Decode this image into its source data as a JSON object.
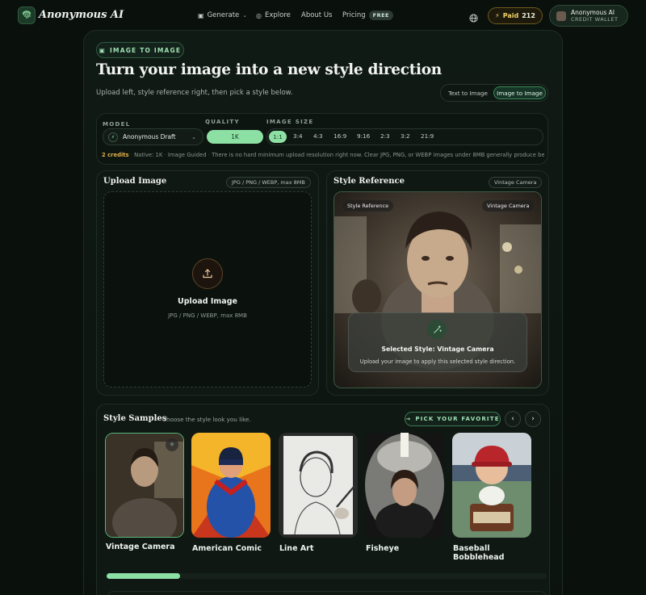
{
  "nav": {
    "brand": "Anonymous AI",
    "links": {
      "generate": "Generate",
      "explore": "Explore",
      "about": "About Us",
      "pricing": "Pricing"
    },
    "free_badge": "FREE",
    "paid_label": "Paid",
    "paid_count": "212",
    "wallet_name": "Anonymous AI",
    "wallet_sub": "CREDIT WALLET"
  },
  "hero": {
    "chip": "IMAGE TO IMAGE",
    "title": "Turn your image into a new style direction",
    "subtitle": "Upload left, style reference right, then pick a style below.",
    "mode_text": "Text to Image",
    "mode_image": "Image to Image"
  },
  "settings": {
    "model_label": "MODEL",
    "model_value": "Anonymous Draft",
    "quality_label": "QUALITY",
    "quality_value": "1K",
    "size_label": "IMAGE SIZE",
    "sizes": [
      "1:1",
      "3:4",
      "4:3",
      "16:9",
      "9:16",
      "2:3",
      "3:2",
      "21:9"
    ],
    "selected_size": "1:1",
    "credits": "2 credits",
    "native": "Native: 1K",
    "guided": "Image Guided",
    "note": "There is no hard minimum upload resolution right now. Clear JPG, PNG, or WEBP images under 8MB generally produce be..."
  },
  "upload": {
    "title": "Upload Image",
    "formats_pill": "JPG / PNG / WEBP, max 8MB",
    "cta": "Upload Image",
    "hint": "JPG / PNG / WEBP, max 8MB"
  },
  "reference": {
    "title": "Style Reference",
    "style_pill": "Vintage Camera",
    "photo_tag": "Style Reference",
    "photo_style": "Vintage Camera",
    "selected": "Selected Style: Vintage Camera",
    "hint": "Upload your image to apply this selected style direction."
  },
  "samples": {
    "title": "Style Samples",
    "subtitle": "Choose the style look you like.",
    "pick_label": "PICK YOUR FAVORITE",
    "items": [
      "Vintage Camera",
      "American Comic",
      "Line Art",
      "Fisheye",
      "Baseball Bobblehead"
    ],
    "scroll_progress": 0.17
  },
  "colors": {
    "accent": "#8de0a4",
    "gold": "#e0b14a",
    "bg": "#0a100c"
  }
}
